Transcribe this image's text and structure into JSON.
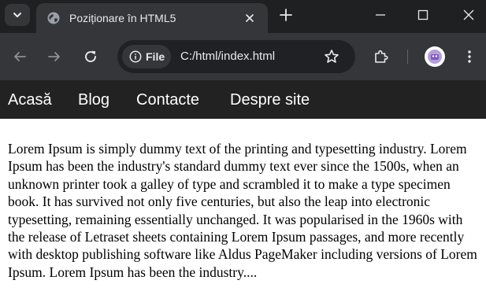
{
  "browser": {
    "tab": {
      "title": "Poziționare în HTML5"
    },
    "omnibox": {
      "scheme_chip": "File",
      "url": "C:/html/index.html"
    }
  },
  "site": {
    "nav": [
      "Acasă",
      "Blog",
      "Contacte",
      "Despre site"
    ],
    "body_text": "Lorem Ipsum is simply dummy text of the printing and typesetting industry. Lorem Ipsum has been the industry's standard dummy text ever since the 1500s, when an unknown printer took a galley of type and scrambled it to make a type specimen book. It has survived not only five centuries, but also the leap into electronic typesetting, remaining essentially unchanged. It was popularised in the 1960s with the release of Letraset sheets containing Lorem Ipsum passages, and more recently with desktop publishing software like Aldus PageMaker including versions of Lorem Ipsum. Lorem Ipsum has been the industry...."
  },
  "colors": {
    "tabstrip_bg": "#1f2022",
    "toolbar_bg": "#35363a",
    "omnibox_bg": "#202124",
    "site_nav_bg": "#222222",
    "page_bg": "#ffffff"
  },
  "icons": {
    "tab_menu": "chevron-down-icon",
    "tab_favicon": "globe-icon",
    "tab_close": "close-icon",
    "new_tab": "plus-icon",
    "window": [
      "minimize-icon",
      "maximize-icon",
      "close-icon"
    ],
    "navigation": [
      "back-arrow-icon",
      "forward-arrow-icon",
      "reload-icon"
    ],
    "omnibox": [
      "info-icon",
      "star-icon"
    ],
    "toolbar_right": [
      "extensions-icon",
      "profile-avatar",
      "kebab-menu-icon"
    ]
  }
}
